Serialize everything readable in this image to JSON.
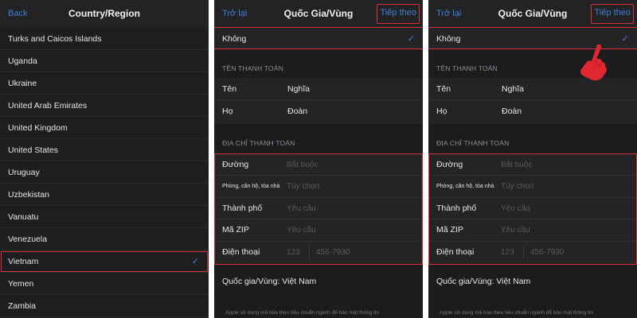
{
  "panel1": {
    "back_label": "Back",
    "title": "Country/Region",
    "countries": [
      "Turks and Caicos Islands",
      "Uganda",
      "Ukraine",
      "United Arab Emirates",
      "United Kingdom",
      "United States",
      "Uruguay",
      "Uzbekistan",
      "Vanuatu",
      "Venezuela",
      "Vietnam",
      "Yemen",
      "Zambia"
    ],
    "selected_country": "Vietnam",
    "check_glyph": "✓"
  },
  "form": {
    "back_label": "Trở lại",
    "title": "Quốc Gia/Vùng",
    "next_label": "Tiếp theo",
    "payment_none_label": "Không",
    "check_glyph": "✓",
    "billing_name_header": "TÊN THANH TOÁN",
    "first_name_label": "Tên",
    "first_name_value": "Nghĩa",
    "last_name_label": "Họ",
    "last_name_value": "Đoàn",
    "billing_address_header": "ĐỊA CHỈ THANH TOÁN",
    "street_label": "Đường",
    "street_placeholder": "Bắt buộc",
    "apt_label": "Phòng, căn hộ, tòa nhà",
    "apt_placeholder": "Tùy chọn",
    "city_label": "Thành phố",
    "city_placeholder": "Yêu cầu",
    "zip_label": "Mã ZIP",
    "zip_placeholder": "Yêu cầu",
    "phone_label": "Điện thoại",
    "phone_area_placeholder": "123",
    "phone_number_placeholder": "456-7930",
    "country_line": "Quốc gia/Vùng: Việt Nam",
    "footer_note": "Apple sử dụng mã hóa theo tiêu chuẩn ngành để bảo mật thông tin"
  },
  "colors": {
    "accent": "#3f7fd6",
    "highlight": "#d8323a",
    "background": "#1c1c1e"
  },
  "icons": {
    "check": "checkmark-icon",
    "hand": "pointing-hand-icon"
  }
}
